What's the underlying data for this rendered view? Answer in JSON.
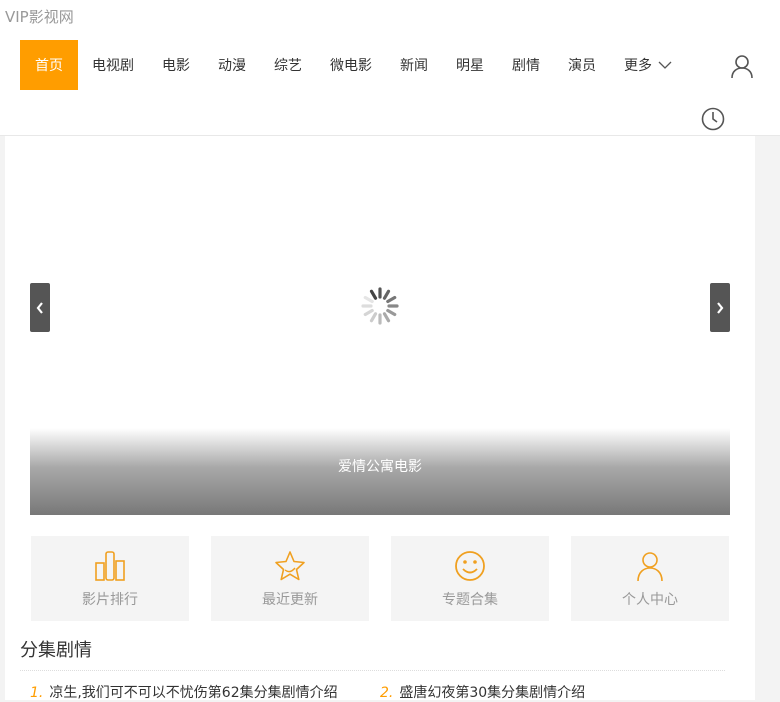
{
  "site": {
    "logo": "VIP影视网"
  },
  "nav": {
    "items": [
      "首页",
      "电视剧",
      "电影",
      "动漫",
      "综艺",
      "微电影",
      "新闻",
      "明星",
      "剧情",
      "演员"
    ],
    "more_label": "更多",
    "active_index": 0,
    "accent_color": "#ff9d00"
  },
  "header_icons": {
    "user": "user-icon",
    "history": "clock-icon"
  },
  "banner": {
    "caption": "爱情公寓电影",
    "prev_icon": "chevron-left-icon",
    "next_icon": "chevron-right-icon",
    "loading_icon": "spinner-icon"
  },
  "quick_links": [
    {
      "label": "影片排行",
      "icon": "bar-chart-icon"
    },
    {
      "label": "最近更新",
      "icon": "star-icon"
    },
    {
      "label": "专题合集",
      "icon": "smiley-icon"
    },
    {
      "label": "个人中心",
      "icon": "user-icon"
    }
  ],
  "episodes": {
    "title": "分集剧情",
    "items": [
      {
        "num": "1.",
        "text": "凉生,我们可不可以不忧伤第62集分集剧情介绍"
      },
      {
        "num": "2.",
        "text": "盛唐幻夜第30集分集剧情介绍"
      }
    ]
  }
}
